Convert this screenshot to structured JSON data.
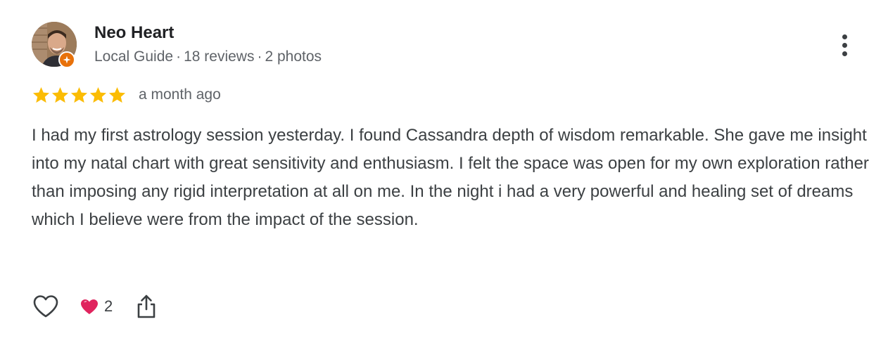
{
  "reviewer": {
    "name": "Neo Heart",
    "badge": "Local Guide",
    "reviews": "18 reviews",
    "photos": "2 photos",
    "separator": "·"
  },
  "review": {
    "rating": 5,
    "max_rating": 5,
    "time": "a month ago",
    "text": "I had my first astrology session yesterday. I found Cassandra depth of wisdom remarkable. She gave me insight into my natal chart with great sensitivity and enthusiasm. I felt the space was open for my own exploration rather than imposing any rigid interpretation at all on me. In the night i had a very powerful and healing set of dreams which I believe were from the impact of the session."
  },
  "actions": {
    "like_icon": "heart-outline-icon",
    "reaction_icon": "red-heart-icon",
    "reaction_count": "2",
    "share_icon": "share-icon",
    "more_icon": "more-vertical-icon"
  },
  "colors": {
    "star": "#fbbc04",
    "badge": "#e8710a",
    "reaction_heart": "#e0245e",
    "text_primary": "#202124",
    "text_secondary": "#5f6368"
  }
}
